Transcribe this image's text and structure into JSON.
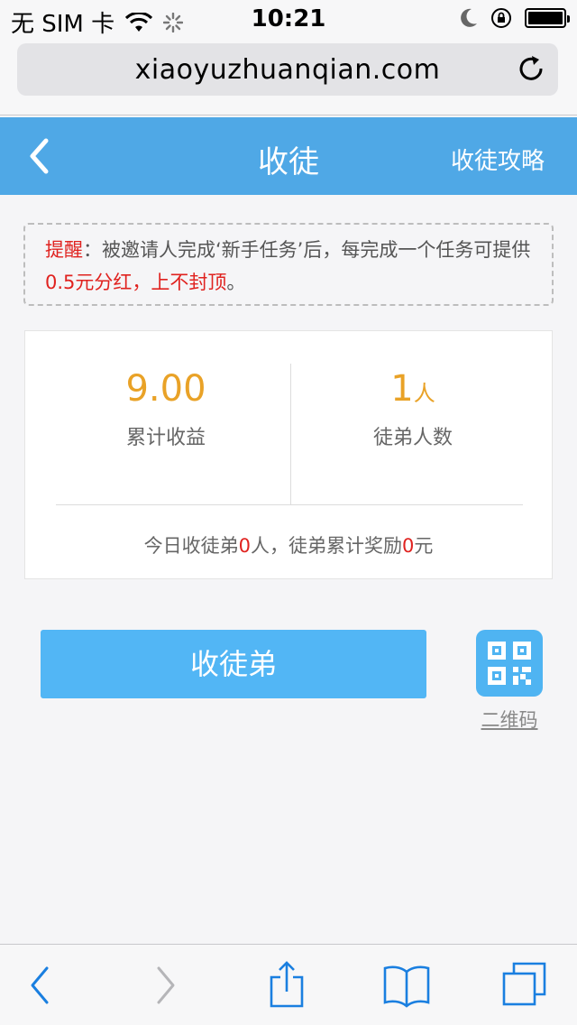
{
  "status_bar": {
    "carrier": "无 SIM 卡",
    "time": "10:21",
    "battery_level": 1.0
  },
  "browser": {
    "url": "xiaoyuzhuanqian.com"
  },
  "header": {
    "title": "收徒",
    "link": "收徒攻略"
  },
  "notice": {
    "label": "提醒",
    "colon": "：",
    "text": "被邀请人完成‘新手任务’后，每完成一个任务可提供",
    "highlight": "0.5元分红，上不封顶",
    "end": "。"
  },
  "stats": {
    "earnings_value": "9.00",
    "earnings_label": "累计收益",
    "disciples_value": "1",
    "disciples_unit": "人",
    "disciples_label": "徒弟人数",
    "summary_prefix": "今日收徒弟",
    "today_count": "0",
    "summary_middle": "人，徒弟累计奖励",
    "total_reward": "0",
    "summary_suffix": "元"
  },
  "actions": {
    "recruit_label": "收徒弟",
    "qr_label": "二维码"
  },
  "colors": {
    "header_blue": "#4fa8e6",
    "button_blue": "#52b6f5",
    "accent_orange": "#e9a227",
    "highlight_red": "#e0221f"
  },
  "icons": {
    "wifi": "wifi-icon",
    "loading": "loading-spinner-icon",
    "moon": "moon-icon",
    "rotation_lock": "rotation-lock-icon",
    "reload": "reload-icon",
    "back": "chevron-left-icon",
    "qr": "qr-code-icon",
    "share": "share-icon",
    "bookmarks": "book-icon",
    "tabs": "tabs-icon"
  }
}
